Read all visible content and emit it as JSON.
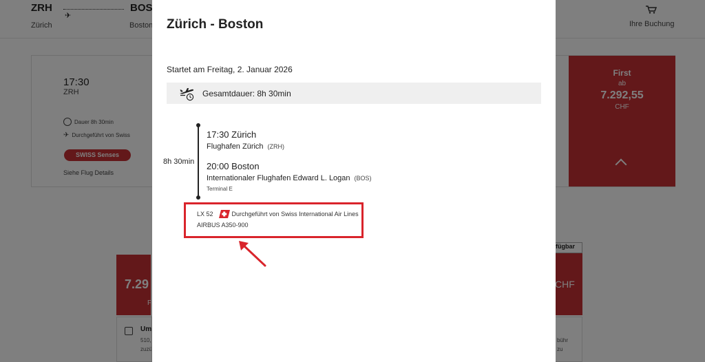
{
  "background": {
    "origin_code": "ZRH",
    "origin_city": "Zürich",
    "dest_code": "BOS",
    "dest_city": "Boston",
    "booking_label": "Ihre Buchung",
    "card_time": "17:30",
    "card_code": "ZRH",
    "card_duration": "Dauer 8h 30min",
    "card_operated": "Durchgeführt von Swiss",
    "card_badge": "SWISS Senses",
    "card_details": "Siehe Flug Details",
    "first_label": "First",
    "first_from": "ab",
    "first_price": "7.292,55",
    "first_currency": "CHF",
    "lower_price_partial": "7.29",
    "lower_price_sub": "F",
    "available_tag_partial": "fügbar",
    "right_price_partial": "CHF",
    "lower_heading_partial": "Um",
    "lower_line1_partial": "510,",
    "lower_line2_partial": "zuzü",
    "right_line1_partial": "bühr",
    "right_line2_partial": "zu"
  },
  "modal": {
    "title": "Zürich - Boston",
    "start_date": "Startet am Freitag, 2. Januar 2026",
    "total_duration": "Gesamtdauer: 8h 30min",
    "segment_duration": "8h 30min",
    "departure": {
      "time_city": "17:30 Zürich",
      "airport": "Flughafen Zürich",
      "code": "(ZRH)"
    },
    "arrival": {
      "time_city": "20:00 Boston",
      "airport": "Internationaler Flughafen Edward L. Logan",
      "code": "(BOS)",
      "terminal": "Terminal E"
    },
    "flight": {
      "number": "LX 52",
      "operated_by": "Durchgeführt von Swiss International Air Lines",
      "aircraft": "AIRBUS A350-900"
    }
  },
  "colors": {
    "swiss_red": "#c63035",
    "highlight_red": "#d9242b"
  },
  "icons": [
    "plane-icon",
    "cart-icon",
    "clock-icon",
    "departure-clock-icon",
    "swiss-logo-icon",
    "chevron-up-icon",
    "annotation-arrow-icon"
  ]
}
